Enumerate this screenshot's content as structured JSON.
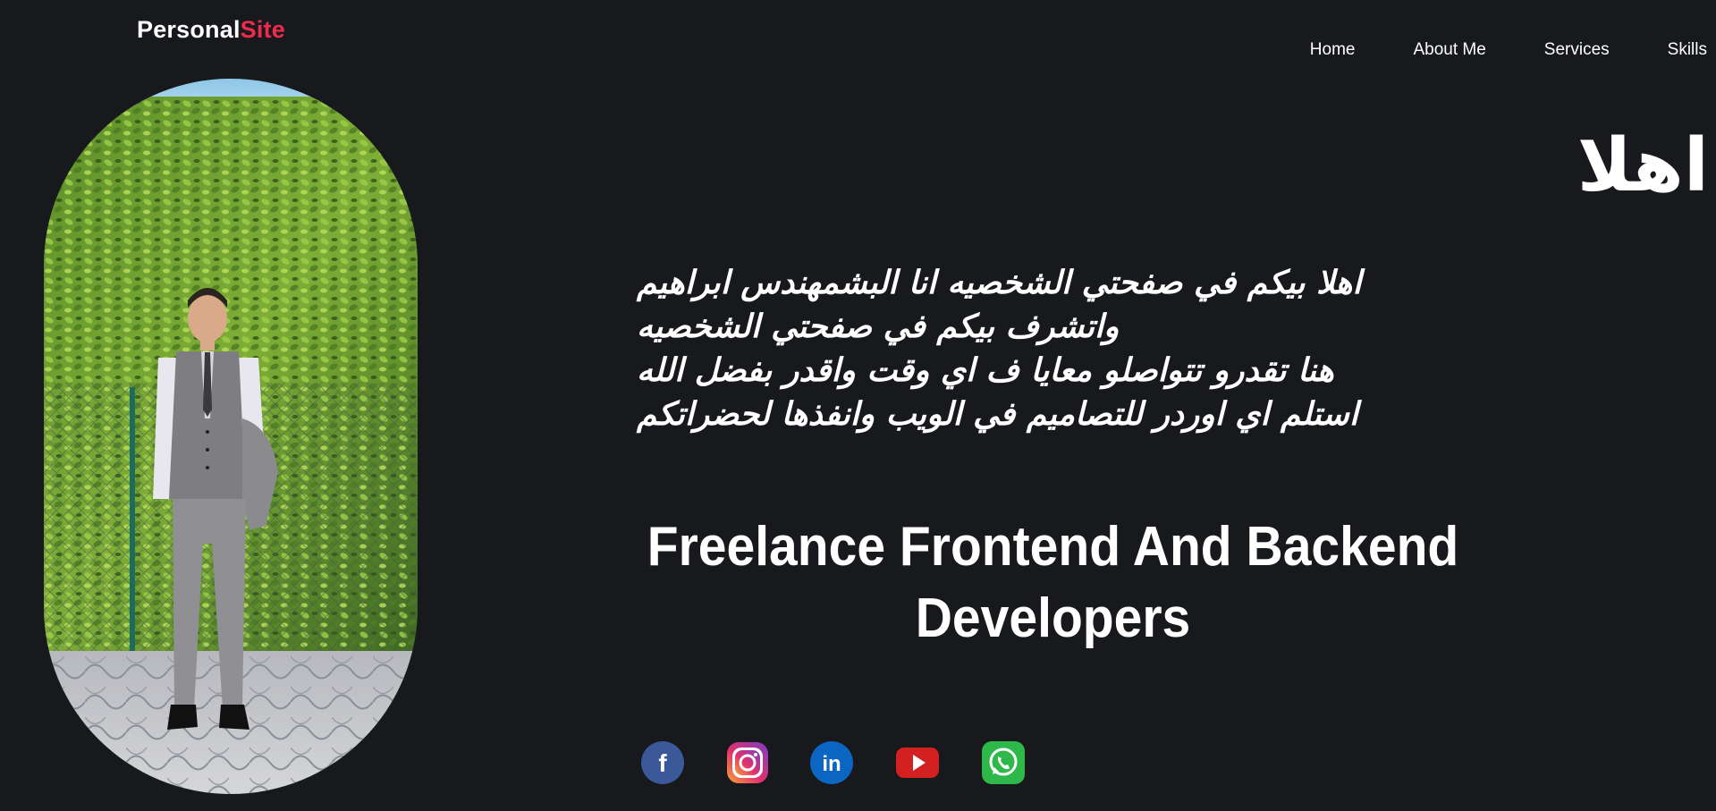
{
  "logo": {
    "part1": "Personal",
    "part2": "Site",
    "accent_color": "#ef2b4d"
  },
  "nav": {
    "items": [
      {
        "label": "Home"
      },
      {
        "label": "About Me"
      },
      {
        "label": "Services"
      },
      {
        "label": "Skills"
      }
    ]
  },
  "hero": {
    "photo_alt": "portrait-photo",
    "hello": "اهلا",
    "intro_lines": [
      "اهلا بيكم في صفحتي الشخصيه انا البشمهندس ابراهيم",
      "واتشرف بيكم في صفحتي الشخصيه",
      "هنا تقدرو تتواصلو معايا ف اي وقت واقدر بفضل الله",
      "استلم اي اوردر للتصاميم في الويب وانفذها لحضراتكم"
    ],
    "tagline_line1": "Freelance Frontend And Backend",
    "tagline_line2": "Developers"
  },
  "socials": [
    {
      "icon": "facebook-icon",
      "glyph": "f",
      "color": "#3b5998"
    },
    {
      "icon": "instagram-icon",
      "color": "#e1306c"
    },
    {
      "icon": "linkedin-icon",
      "glyph": "in",
      "color": "#0a66c2"
    },
    {
      "icon": "youtube-icon",
      "color": "#d32020"
    },
    {
      "icon": "whatsapp-icon",
      "color": "#2fb84a"
    }
  ],
  "colors": {
    "background": "#17191c",
    "text": "#ffffff"
  }
}
